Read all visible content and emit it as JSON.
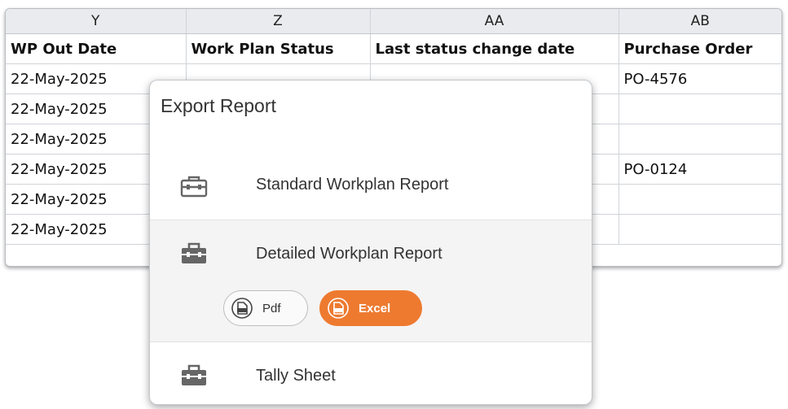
{
  "sheet": {
    "columns": [
      "Y",
      "Z",
      "AA",
      "AB"
    ],
    "headers": [
      "WP Out Date",
      "Work Plan Status",
      "Last status change date",
      "Purchase Order"
    ],
    "rows": [
      [
        "22-May-2025",
        "",
        "",
        "PO-4576"
      ],
      [
        "22-May-2025",
        "",
        "",
        ""
      ],
      [
        "22-May-2025",
        "",
        "",
        ""
      ],
      [
        "22-May-2025",
        "",
        "",
        "PO-0124"
      ],
      [
        "22-May-2025",
        "",
        "",
        ""
      ],
      [
        "22-May-2025",
        "",
        "",
        ""
      ]
    ]
  },
  "popup": {
    "title": "Export Report",
    "items": [
      {
        "label": "Standard Workplan Report",
        "icon": "toolbox-outline-icon"
      },
      {
        "label": "Detailed Workplan Report",
        "icon": "toolbox-filled-icon"
      },
      {
        "label": "Tally Sheet",
        "icon": "toolbox-filled-icon"
      }
    ],
    "buttons": {
      "pdf": {
        "label": "Pdf",
        "icon": "pdf-file-icon"
      },
      "excel": {
        "label": "Excel",
        "icon": "xls-file-icon"
      }
    }
  },
  "colors": {
    "accent": "#ee7a30",
    "header_bg": "#e9ebee",
    "selected_item_bg": "#f4f4f4",
    "icon_gray": "#666666"
  }
}
